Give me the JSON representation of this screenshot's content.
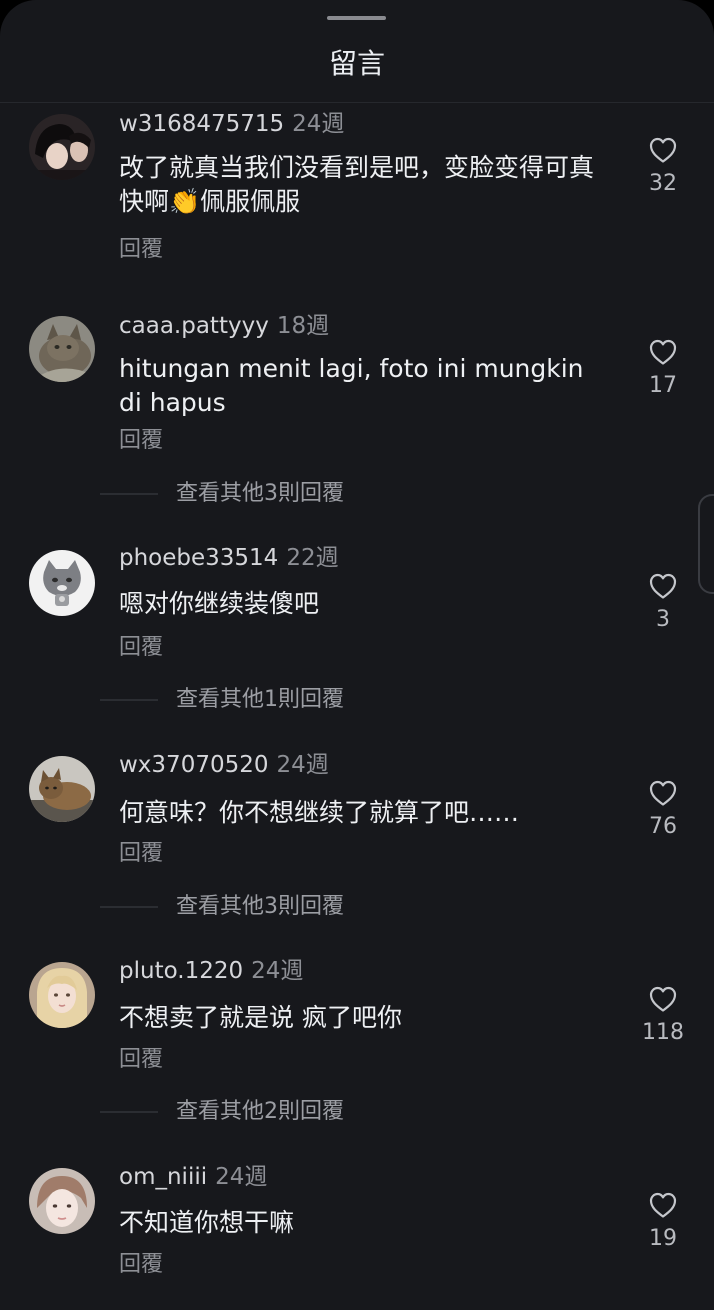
{
  "header": {
    "title": "留言"
  },
  "actions": {
    "reply_label": "回覆"
  },
  "comments": [
    {
      "username": "w3168475715",
      "time": "24週",
      "text": "改了就真当我们没看到是吧，变脸变得可真快啊👏佩服佩服",
      "likes": "32"
    },
    {
      "username": "caaa.pattyyy",
      "time": "18週",
      "text": "hitungan menit lagi, foto ini mungkin di hapus",
      "likes": "17",
      "more": "查看其他3則回覆"
    },
    {
      "username": "phoebe33514",
      "time": "22週",
      "text": "嗯对你继续装傻吧",
      "likes": "3",
      "more": "查看其他1則回覆"
    },
    {
      "username": "wx37070520",
      "time": "24週",
      "text": "何意味？你不想继续了就算了吧……",
      "likes": "76",
      "more": "查看其他3則回覆"
    },
    {
      "username": "pluto.1220",
      "time": "24週",
      "text": "不想卖了就是说 疯了吧你",
      "likes": "118",
      "more": "查看其他2則回覆"
    },
    {
      "username": "om_niiii",
      "time": "24週",
      "text": "不知道你想干嘛",
      "likes": "19"
    }
  ],
  "colors": {
    "sheet_background": "#17181c",
    "text_primary": "#eef0f3",
    "text_secondary": "#8d8f95"
  },
  "icons": {
    "like": "heart-outline-icon"
  }
}
